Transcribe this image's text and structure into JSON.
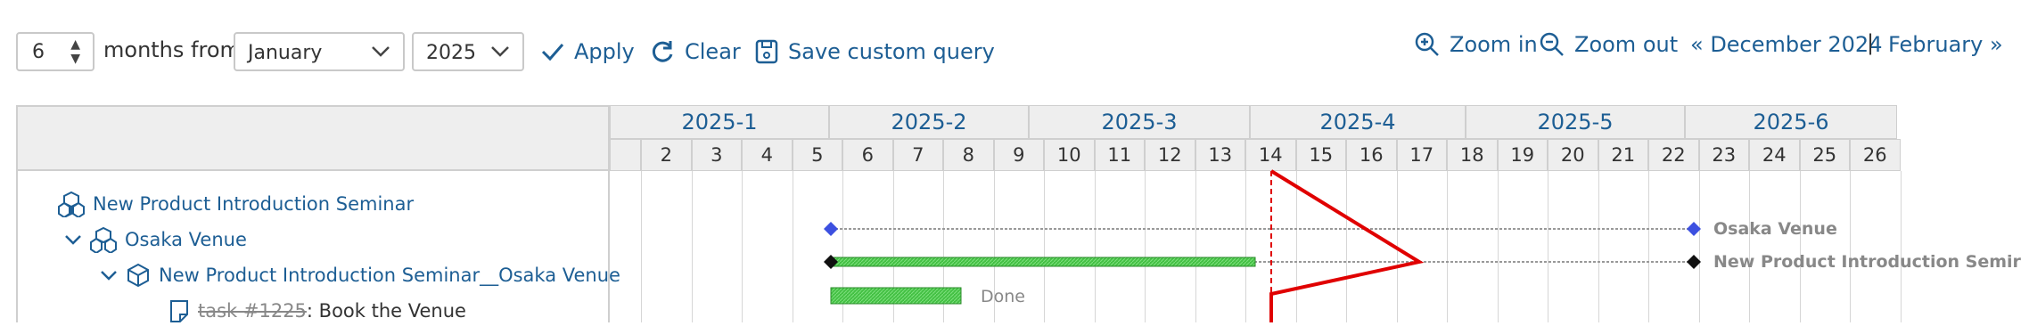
{
  "toolbar": {
    "months_value": "6",
    "months_from_label": "months from",
    "month_select": "January",
    "year_select": "2025",
    "apply_label": "Apply",
    "clear_label": "Clear",
    "save_label": "Save custom query",
    "zoom_in_label": "Zoom in",
    "zoom_out_label": "Zoom out",
    "prev_link": "« December 2024",
    "separator": "|",
    "next_link": "February »"
  },
  "gantt": {
    "months": [
      "2025-1",
      "2025-2",
      "2025-3",
      "2025-4",
      "2025-5",
      "2025-6"
    ],
    "weeks": [
      "2",
      "3",
      "4",
      "5",
      "6",
      "7",
      "8",
      "9",
      "10",
      "11",
      "12",
      "13",
      "14",
      "15",
      "16",
      "17",
      "18",
      "19",
      "20",
      "21",
      "22",
      "23",
      "24",
      "25",
      "26"
    ],
    "tree": [
      {
        "label": "New Product Introduction Seminar",
        "icon": "project-icon"
      },
      {
        "label": "Osaka Venue",
        "icon": "project-icon"
      },
      {
        "label": "New Product Introduction Seminar__Osaka Venue",
        "icon": "version-icon"
      },
      {
        "task_id": "task #1225",
        "title": ": Book the Venue",
        "icon": "task-icon"
      }
    ],
    "bar_labels": {
      "osaka": "Osaka Venue",
      "seminar": "New Product Introduction Semir",
      "done": "Done"
    },
    "colors": {
      "progress": "#44c044",
      "today_line": "#e00000",
      "diamond_blue": "#3c50e0",
      "diamond_black": "#111111"
    }
  }
}
